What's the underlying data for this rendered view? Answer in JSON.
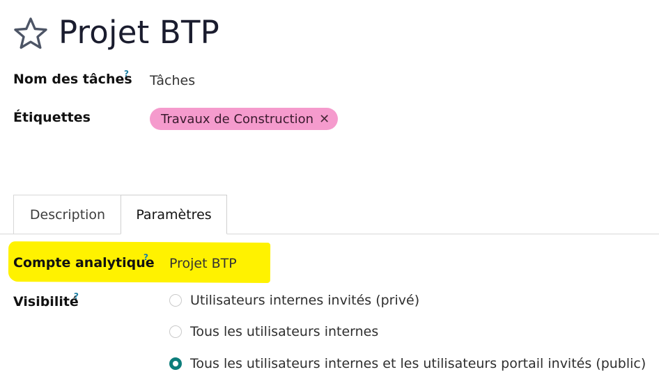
{
  "header": {
    "title": "Projet BTP",
    "star_icon": "star-outline-icon"
  },
  "fields": {
    "task_name": {
      "label": "Nom des tâches",
      "help": "?",
      "value": "Tâches"
    },
    "tags": {
      "label": "Étiquettes",
      "items": [
        {
          "label": "Travaux de Construction",
          "remove_symbol": "✕",
          "color": "#f59bcd"
        }
      ]
    }
  },
  "tabs": [
    {
      "label": "Description",
      "active": false
    },
    {
      "label": "Paramètres",
      "active": true
    }
  ],
  "settings": {
    "analytic_account": {
      "label": "Compte analytique",
      "help": "?",
      "value": "Projet BTP",
      "highlight_color": "#fff200"
    },
    "visibility": {
      "label": "Visibilité",
      "help": "?",
      "options": [
        {
          "label": "Utilisateurs internes invités (privé)",
          "checked": false
        },
        {
          "label": "Tous les utilisateurs internes",
          "checked": false
        },
        {
          "label": "Tous les utilisateurs internes et les utilisateurs portail invités (public)",
          "checked": true
        }
      ]
    }
  },
  "colors": {
    "accent": "#0d7d7b",
    "help": "#1b7ea3"
  }
}
